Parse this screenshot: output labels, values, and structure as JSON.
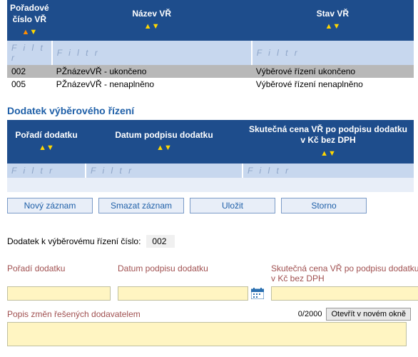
{
  "table1": {
    "headers": [
      "Pořadové číslo VŘ",
      "Název VŘ",
      "Stav VŘ"
    ],
    "filter_text": "F i l t r",
    "rows": [
      [
        "002",
        "PŽnázevVŘ - ukončeno",
        "Výběrové řízení ukončeno"
      ],
      [
        "005",
        "PŽnázevVŘ - nenaplněno",
        "Výběrové řízení nenaplněno"
      ]
    ]
  },
  "section2_title": "Dodatek výběrového řízení",
  "table2": {
    "headers": [
      "Pořadí dodatku",
      "Datum podpisu dodatku",
      "Skutečná cena VŘ po podpisu dodatku v Kč bez DPH"
    ],
    "filter_text": "F i l t r"
  },
  "buttons": {
    "new": "Nový záznam",
    "delete": "Smazat záznam",
    "save": "Uložit",
    "cancel": "Storno"
  },
  "form": {
    "cislo_label": "Dodatek k výběrovému řízení číslo:",
    "cislo_value": "002",
    "poradi_label": "Pořadí dodatku",
    "datum_label": "Datum podpisu dodatku",
    "cena_label": "Skutečná cena VŘ po podpisu dodatku v Kč bez DPH",
    "popis_label": "Popis změn řešených dodavatelem",
    "counter": "0/2000",
    "open_btn": "Otevřít v novém okně"
  }
}
